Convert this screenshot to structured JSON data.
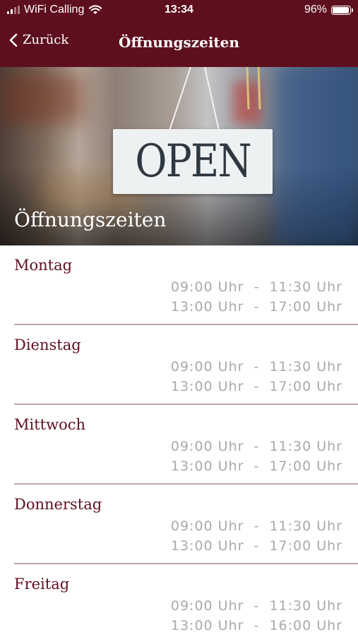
{
  "status_bar": {
    "carrier": "WiFi Calling",
    "time": "13:34",
    "battery": "96%",
    "battery_level": 0.96
  },
  "nav": {
    "back_label": "Zurück",
    "title": "Öffnungszeiten"
  },
  "hero": {
    "sign_text": "OPEN",
    "title": "Öffnungszeiten"
  },
  "schedule": [
    {
      "day": "Montag",
      "slots": [
        "09:00 Uhr  -  11:30 Uhr",
        "13:00 Uhr  -  17:00 Uhr"
      ]
    },
    {
      "day": "Dienstag",
      "slots": [
        "09:00 Uhr  -  11:30 Uhr",
        "13:00 Uhr  -  17:00 Uhr"
      ]
    },
    {
      "day": "Mittwoch",
      "slots": [
        "09:00 Uhr  -  11:30 Uhr",
        "13:00 Uhr  -  17:00 Uhr"
      ]
    },
    {
      "day": "Donnerstag",
      "slots": [
        "09:00 Uhr  -  11:30 Uhr",
        "13:00 Uhr  -  17:00 Uhr"
      ]
    },
    {
      "day": "Freitag",
      "slots": [
        "09:00 Uhr  -  11:30 Uhr",
        "13:00 Uhr  -  16:00 Uhr"
      ]
    }
  ],
  "colors": {
    "brand": "#5e0f1e",
    "time_text": "#a9a9a9",
    "divider": "#b7a8ab"
  }
}
